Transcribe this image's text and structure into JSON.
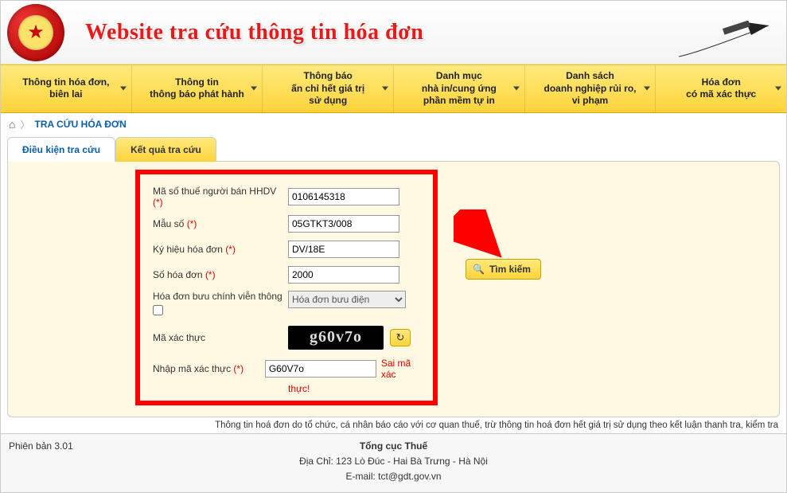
{
  "header": {
    "title": "Website tra cứu thông tin hóa đơn"
  },
  "nav": {
    "items": [
      "Thông tin hóa đơn,\nbiên lai",
      "Thông tin\nthông báo phát hành",
      "Thông báo\nấn chỉ hết giá trị\nsử dụng",
      "Danh mục\nnhà in/cung ứng\nphần mềm tự in",
      "Danh sách\ndoanh nghiệp rủi ro,\nvi phạm",
      "Hóa đơn\ncó mã xác thực"
    ]
  },
  "breadcrumb": {
    "home_glyph": "⌂",
    "sep_glyph": "〉",
    "current": "TRA CỨU HÓA ĐƠN"
  },
  "tabs": {
    "active": "Điều kiện tra cứu",
    "other": "Kết quả tra cứu"
  },
  "form": {
    "mst_label": "Mã số thuế người bán HHDV",
    "mst_value": "0106145318",
    "mauso_label": "Mẫu số",
    "mauso_value": "05GTKT3/008",
    "kyhieu_label": "Ký hiệu hóa đơn",
    "kyhieu_value": "DV/18E",
    "sohd_label": "Số hóa đơn",
    "sohd_value": "2000",
    "buudien_label": "Hóa đơn bưu chính viễn thông",
    "buudien_option": "Hóa đơn bưu điện",
    "captcha_label": "Mã xác thực",
    "captcha_text": "g60v7o",
    "captcha_input_label": "Nhập mã xác thực",
    "captcha_input_value": "G60V7o",
    "captcha_error": "Sai mã xác thực!",
    "req_mark": "(*)"
  },
  "buttons": {
    "search": "Tìm kiếm",
    "refresh_glyph": "↻",
    "search_glyph": "🔍"
  },
  "note": "Thông tin hoá đơn do tổ chức, cá nhân báo cáo với cơ quan thuế, trừ thông tin hoá đơn hết giá trị sử dụng theo kết luận thanh tra, kiểm tra",
  "footer": {
    "version": "Phiên bản 3.01",
    "org": "Tổng cục Thuế",
    "address": "Địa Chỉ: 123 Lò Đúc - Hai Bà Trưng - Hà Nội",
    "email": "E-mail: tct@gdt.gov.vn"
  }
}
